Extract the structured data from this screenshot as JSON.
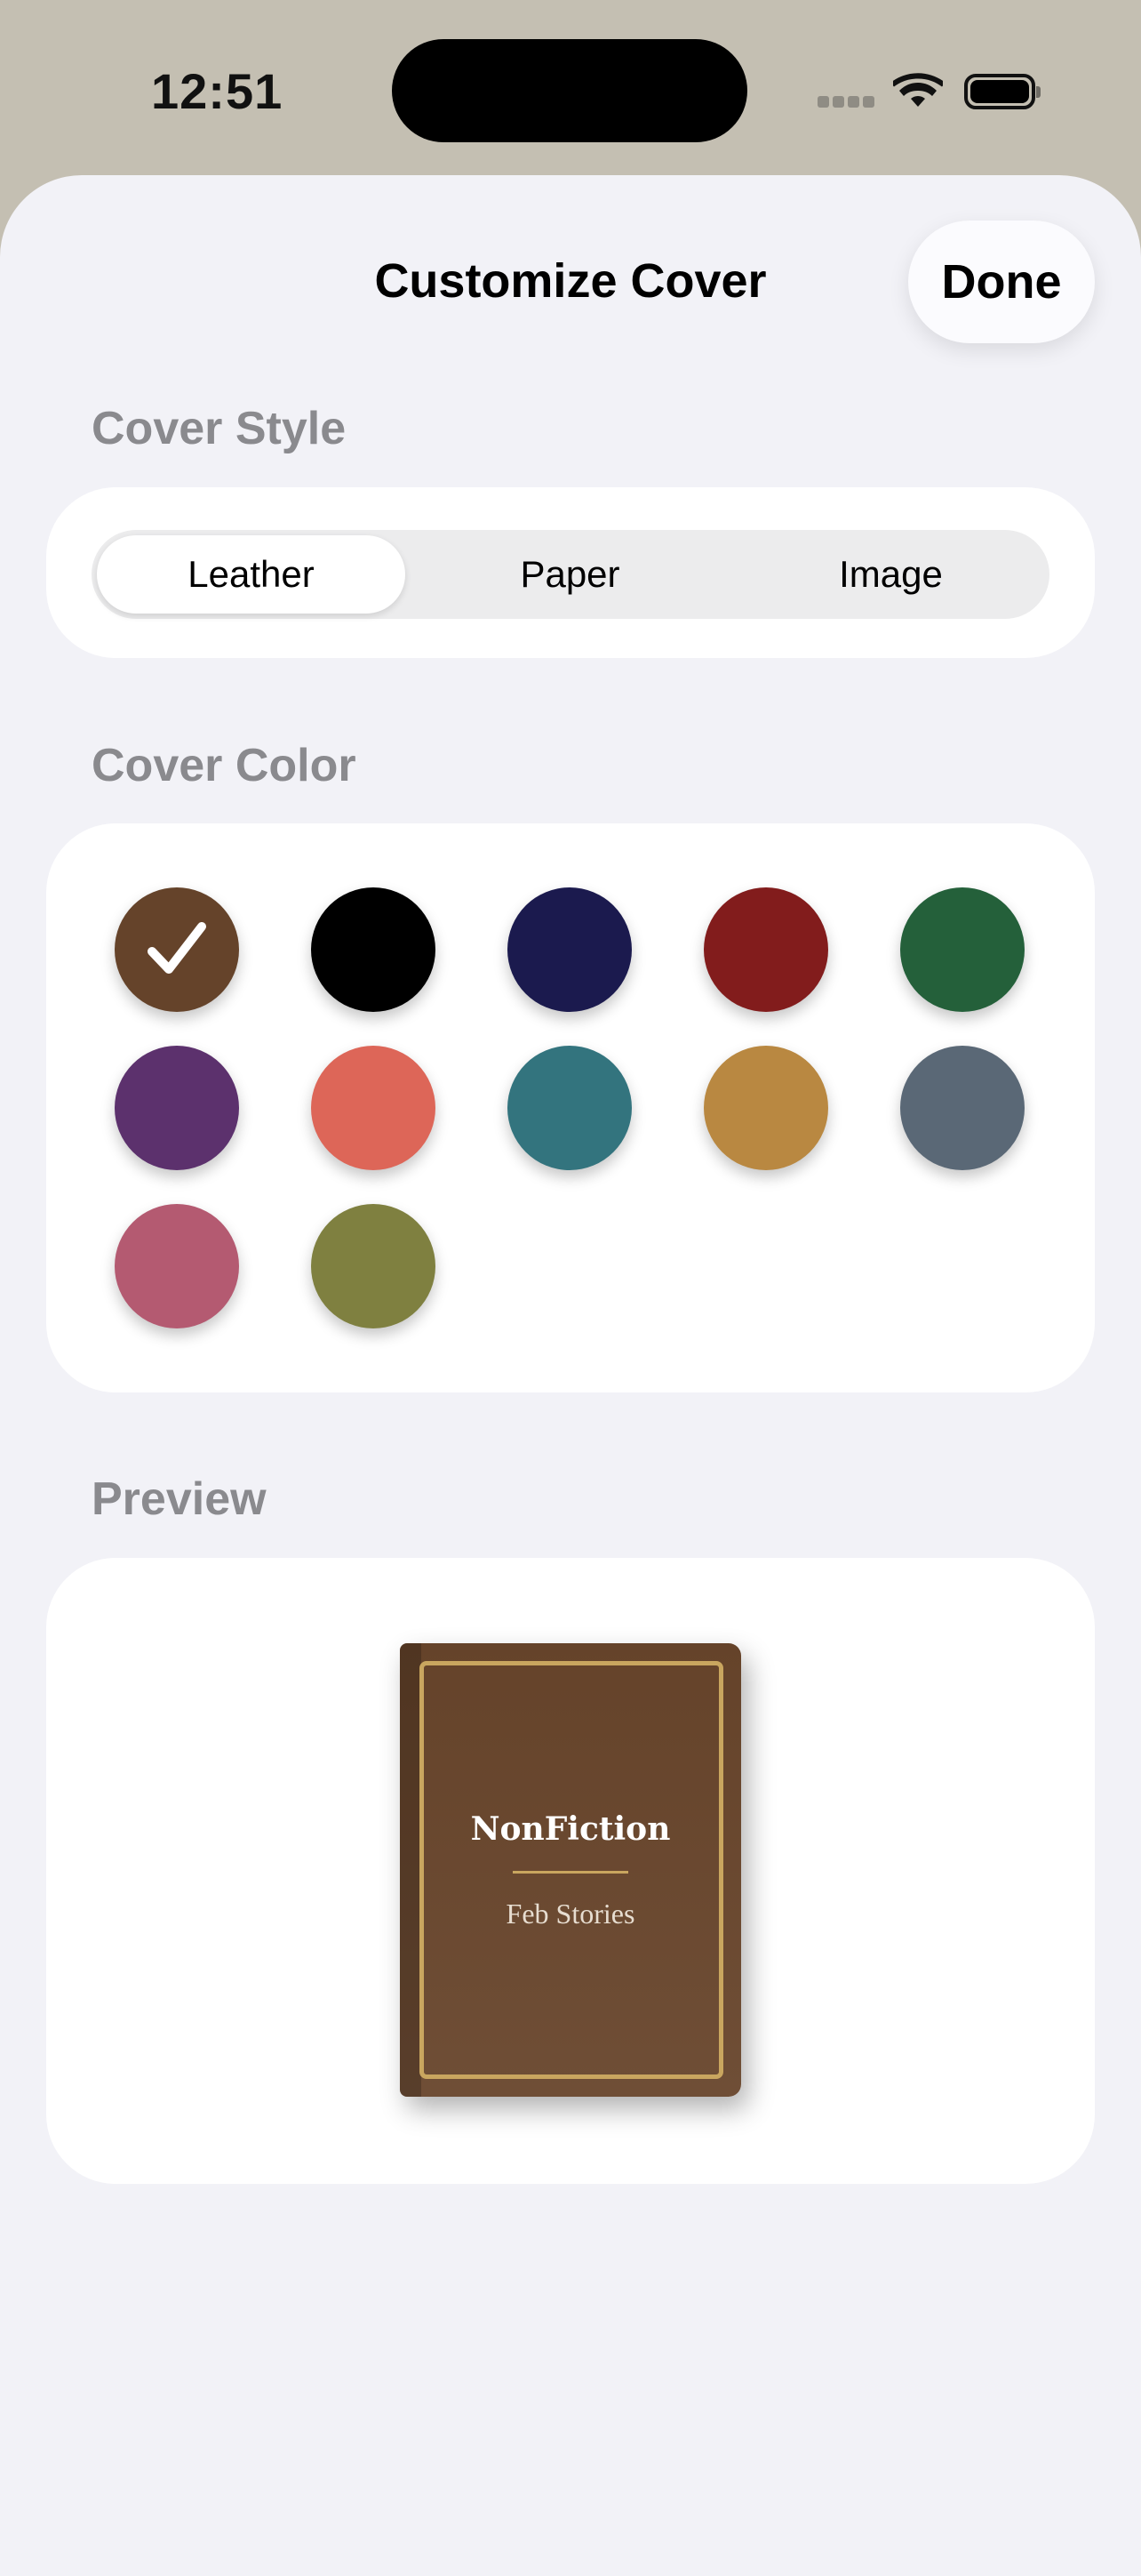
{
  "status_bar": {
    "time": "12:51",
    "icons": [
      "cellular-signal-icon",
      "wifi-icon",
      "battery-icon"
    ]
  },
  "header": {
    "title": "Customize Cover",
    "done_label": "Done"
  },
  "cover_style": {
    "label": "Cover Style",
    "options": [
      "Leather",
      "Paper",
      "Image"
    ],
    "selected": "Leather"
  },
  "cover_color": {
    "label": "Cover Color",
    "selected": "#65432a",
    "colors": [
      "#65432a",
      "#000000",
      "#1b1a4e",
      "#821c1c",
      "#24603a",
      "#5c316d",
      "#dd6658",
      "#33747e",
      "#b98841",
      "#5a6876",
      "#b45a71",
      "#7f8040"
    ]
  },
  "preview": {
    "label": "Preview",
    "book_title": "NonFiction",
    "book_subtitle": "Feb Stories",
    "accent_color": "#c9a65f"
  }
}
